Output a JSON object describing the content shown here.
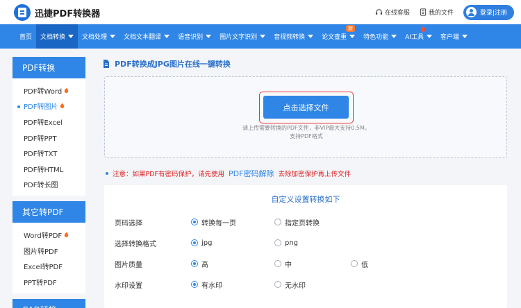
{
  "header": {
    "logo_text": "迅捷PDF转换器",
    "service_label": "在线客服",
    "my_files_label": "我的文件",
    "login_label": "登录|注册"
  },
  "nav": {
    "items": [
      {
        "label": "首页",
        "has_caret": false
      },
      {
        "label": "文档转换",
        "has_caret": true,
        "active": true
      },
      {
        "label": "文档处理",
        "has_caret": true
      },
      {
        "label": "文档文本翻译",
        "has_caret": true
      },
      {
        "label": "语音识别",
        "has_caret": true
      },
      {
        "label": "图片文字识别",
        "has_caret": true
      },
      {
        "label": "音视频转换",
        "has_caret": true
      },
      {
        "label": "论文查重",
        "has_caret": true,
        "badge": "新"
      },
      {
        "label": "特色功能",
        "has_caret": true
      },
      {
        "label": "AI工具",
        "has_caret": true,
        "fire": true
      },
      {
        "label": "客户端",
        "has_caret": true
      }
    ]
  },
  "sidebar": {
    "groups": [
      {
        "title": "PDF转换",
        "items": [
          {
            "label": "PDF转Word",
            "hot": true
          },
          {
            "label": "PDF转图片",
            "hot": true,
            "active": true
          },
          {
            "label": "PDF转Excel"
          },
          {
            "label": "PDF转PPT"
          },
          {
            "label": "PDF转TXT"
          },
          {
            "label": "PDF转HTML"
          },
          {
            "label": "PDF转长图"
          }
        ]
      },
      {
        "title": "其它转PDF",
        "items": [
          {
            "label": "Word转PDF",
            "hot": true
          },
          {
            "label": "图片转PDF"
          },
          {
            "label": "Excel转PDF"
          },
          {
            "label": "PPT转PDF"
          }
        ]
      },
      {
        "title": "CAD转换",
        "items": []
      }
    ]
  },
  "main": {
    "page_title": "PDF转换成JPG图片在线一键转换",
    "select_button": "点击选择文件",
    "upload_hint_line1": "请上传需要转换的PDF文件，非VIP最大支持0.5M，",
    "upload_hint_line2": "支持PDF格式",
    "notice_prefix": "注意：如果PDF有密码保护，请先使用",
    "notice_link": "PDF密码解除",
    "notice_suffix": "去除加密保护再上传文件",
    "settings_title": "自定义设置转换如下",
    "settings": [
      {
        "label": "页码选择",
        "options": [
          {
            "text": "转换每一页",
            "selected": true
          },
          {
            "text": "指定页转换",
            "selected": false
          }
        ]
      },
      {
        "label": "选择转换格式",
        "options": [
          {
            "text": "jpg",
            "selected": true
          },
          {
            "text": "png",
            "selected": false
          }
        ]
      },
      {
        "label": "图片质量",
        "options": [
          {
            "text": "高",
            "selected": true
          },
          {
            "text": "中",
            "selected": false
          },
          {
            "text": "低",
            "selected": false
          }
        ]
      },
      {
        "label": "水印设置",
        "options": [
          {
            "text": "有水印",
            "selected": true
          },
          {
            "text": "无水印",
            "selected": false
          }
        ]
      }
    ]
  },
  "colors": {
    "brand_blue": "#2f86e6",
    "nav_active": "#1a66c4",
    "notice_red": "#e02020",
    "hot_orange": "#ff6a1a"
  }
}
